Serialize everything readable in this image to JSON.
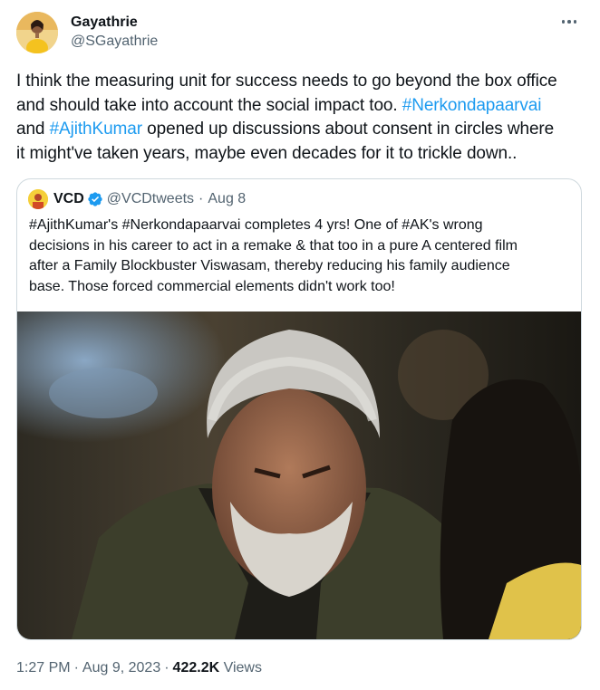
{
  "author": {
    "display_name": "Gayathrie",
    "handle": "@SGayathrie"
  },
  "tweet": {
    "lines": [
      [
        {
          "text": "I think the measuring unit for success needs to go beyond the box office",
          "tag": false
        }
      ],
      [
        {
          "text": "and should take into account the social impact too. ",
          "tag": false
        },
        {
          "text": "#Nerkondapaarvai",
          "tag": true
        }
      ],
      [
        {
          "text": "and ",
          "tag": false
        },
        {
          "text": "#AjithKumar",
          "tag": true
        },
        {
          "text": " opened up discussions about consent in circles where",
          "tag": false
        }
      ],
      [
        {
          "text": "it might've taken years, maybe even decades for it to trickle down..",
          "tag": false
        }
      ]
    ]
  },
  "quote": {
    "display_name": "VCD",
    "handle": "@VCDtweets",
    "separator": "·",
    "date": "Aug 8",
    "lines": [
      "#AjithKumar's #Nerkondapaarvai completes 4 yrs! One of #AK's wrong",
      "decisions in his career to act in a remake & that too in a pure A centered film",
      "after a Family Blockbuster Viswasam, thereby reducing his family audience",
      "base. Those forced commercial elements didn't work too!"
    ]
  },
  "meta": {
    "time": "1:27 PM",
    "date": "Aug 9, 2023",
    "separator": "·",
    "views_count": "422.2K",
    "views_label": "Views"
  },
  "colors": {
    "link": "#1d9bf0",
    "secondary_text": "#536471",
    "border": "#cfd9de",
    "verified": "#1d9bf0"
  },
  "icons": {
    "more": "more-dots-icon",
    "verified": "verified-badge-icon"
  }
}
